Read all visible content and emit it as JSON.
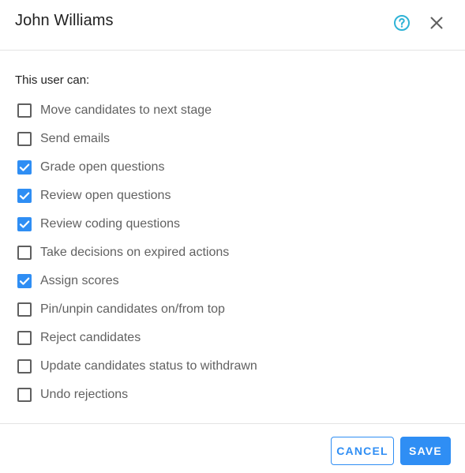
{
  "dialog": {
    "title": "John Williams",
    "help_icon": "help-circle-icon",
    "close_icon": "close-icon"
  },
  "permissions": {
    "section_label": "This user can:",
    "items": [
      {
        "label": "Move candidates to next stage",
        "checked": false
      },
      {
        "label": "Send emails",
        "checked": false
      },
      {
        "label": "Grade open questions",
        "checked": true
      },
      {
        "label": "Review open questions",
        "checked": true
      },
      {
        "label": "Review coding questions",
        "checked": true
      },
      {
        "label": "Take decisions on expired actions",
        "checked": false
      },
      {
        "label": "Assign scores",
        "checked": true
      },
      {
        "label": "Pin/unpin candidates on/from top",
        "checked": false
      },
      {
        "label": "Reject candidates",
        "checked": false
      },
      {
        "label": "Update candidates status to withdrawn",
        "checked": false
      },
      {
        "label": "Undo rejections",
        "checked": false
      }
    ]
  },
  "footer": {
    "cancel_label": "CANCEL",
    "save_label": "SAVE"
  },
  "colors": {
    "accent": "#2f8ef4",
    "help_icon": "#2fb3d6",
    "text_primary": "#212121",
    "text_secondary": "#616161"
  }
}
